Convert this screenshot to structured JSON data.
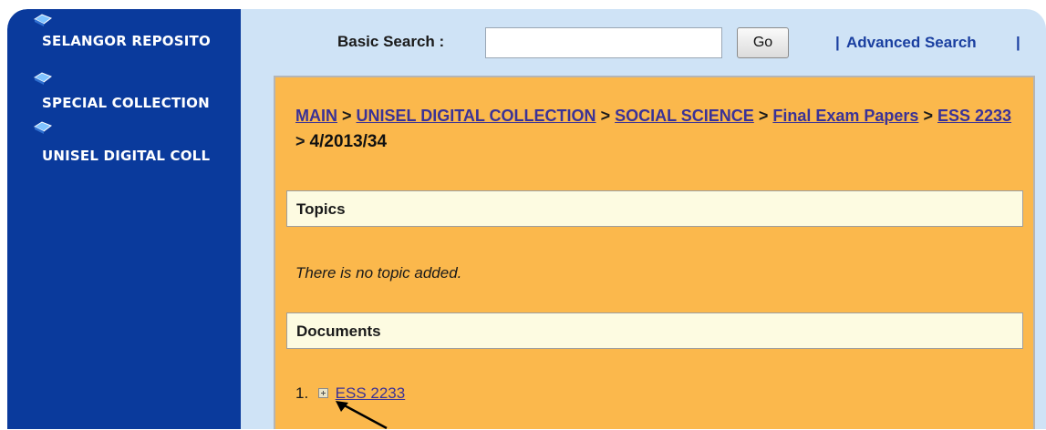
{
  "sidebar": {
    "items": [
      {
        "label": "SELANGOR REPOSITO",
        "icon": "book-icon"
      },
      {
        "label": "SPECIAL COLLECTION",
        "icon": "book-icon"
      },
      {
        "label": "UNISEL DIGITAL COLL",
        "icon": "book-icon"
      }
    ]
  },
  "search": {
    "label": "Basic Search :",
    "value": "",
    "go_label": "Go",
    "advanced_label": "Advanced Search"
  },
  "breadcrumb": {
    "items": [
      "MAIN",
      "UNISEL DIGITAL COLLECTION",
      "SOCIAL SCIENCE",
      "Final Exam Papers",
      "ESS 2233"
    ],
    "separator": ">",
    "current": "4/2013/34"
  },
  "topics": {
    "title": "Topics",
    "empty_message": "There is no topic added."
  },
  "documents": {
    "title": "Documents",
    "items": [
      {
        "number": "1.",
        "label": "ESS 2233"
      }
    ]
  },
  "colors": {
    "sidebar_bg": "#0a3a9c",
    "content_bg": "#fbb84c",
    "section_bar_bg": "#fdfbe1",
    "link": "#3b3296",
    "page_bg": "#cfe3f6"
  }
}
